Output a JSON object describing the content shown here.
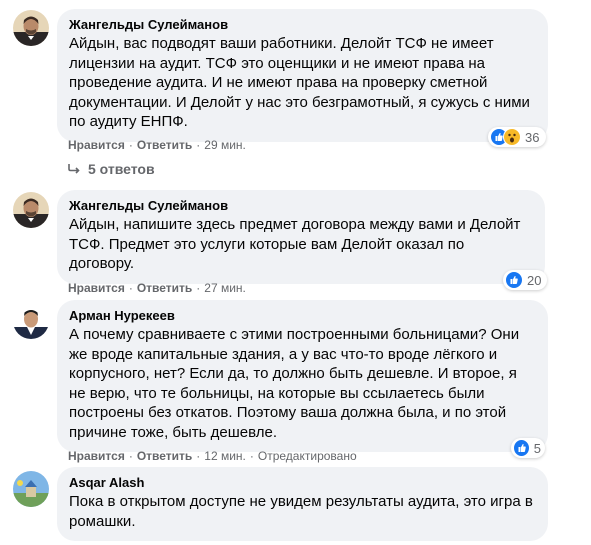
{
  "comments": [
    {
      "author": "Жангельды Сулейманов",
      "text": "Айдын, вас подводят ваши работники. Делойт ТСФ не имеет лицензии на аудит. ТСФ это оценщики и не имеют права на проведение аудита. И не имеют права на проверку сметной документации. И Делойт у нас это безграмотный, я сужусь с ними по аудиту ЕНПФ.",
      "like_label": "Нравится",
      "reply_label": "Ответить",
      "time": "29 мин.",
      "reactions": [
        "like",
        "wow"
      ],
      "reaction_count": "36",
      "replies_label": "5 ответов"
    },
    {
      "author": "Жангельды Сулейманов",
      "text": "Айдын, напишите здесь предмет договора между вами и Делойт ТСФ. Предмет это услуги которые вам Делойт оказал по договору.",
      "like_label": "Нравится",
      "reply_label": "Ответить",
      "time": "27 мин.",
      "reactions": [
        "like"
      ],
      "reaction_count": "20"
    },
    {
      "author": "Арман Нурекеев",
      "text": "А почему сравниваете с этими построенными больницами? Они же вроде капитальные здания, а у вас что-то вроде лёгкого и корпусного, нет? Если да, то должно быть дешевле. И второе, я не верю, что те больницы, на которые вы ссылаетесь были построены без откатов. Поэтому ваша должна была, и по этой причине тоже, быть дешевле.",
      "like_label": "Нравится",
      "reply_label": "Ответить",
      "time": "12 мин.",
      "edited_label": "Отредактировано",
      "reactions": [
        "like"
      ],
      "reaction_count": "5"
    },
    {
      "author": "Asqar Alash",
      "text": "Пока в открытом доступе не увидем результаты аудита, это игра в ромашки."
    }
  ],
  "colors": {
    "bubble": "#f0f2f5",
    "secondary_text": "#65676b",
    "like_blue": "#1877f2",
    "wow_yellow": "#f7b928"
  },
  "icons": {
    "like": "thumbs-up-icon",
    "wow": "wow-face-icon",
    "replies": "reply-arrow-icon"
  }
}
